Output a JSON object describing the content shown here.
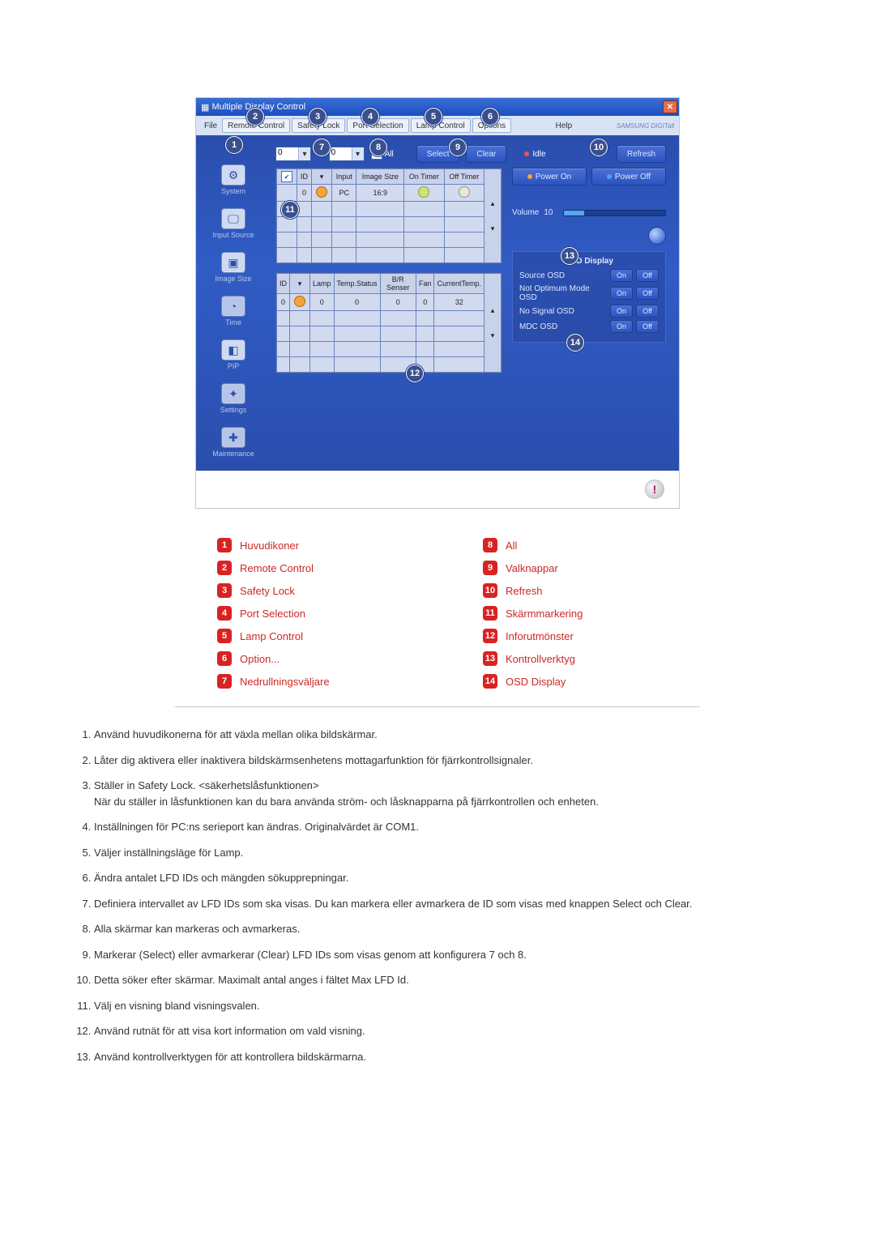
{
  "window": {
    "title": "Multiple Display Control",
    "brand": "SAMSUNG DIGITall"
  },
  "menu": {
    "file": "File",
    "remote": "Remote Control",
    "safety": "Safety Lock",
    "port": "Port Selection",
    "lamp": "Lamp Control",
    "options": "Options",
    "help": "Help"
  },
  "toolbar": {
    "drop1": "0",
    "drop2": "0",
    "all": "All",
    "select": "Select",
    "clear": "Clear",
    "idle": "Idle",
    "refresh": "Refresh"
  },
  "sidebar": {
    "system": "System",
    "input": "Input Source",
    "image": "Image Size",
    "time": "Time",
    "pip": "PIP",
    "settings": "Settings",
    "maint": "Maintenance"
  },
  "grid1": {
    "h_id": "ID",
    "h_input": "Input",
    "h_image": "Image Size",
    "h_on": "On Timer",
    "h_off": "Off Timer",
    "row_id": "0",
    "row_input": "PC",
    "row_image": "16:9"
  },
  "grid2": {
    "h_id": "ID",
    "h_lamp": "Lamp",
    "h_temp": "Temp.Status",
    "h_br": "B/R Senser",
    "h_fan": "Fan",
    "h_cur": "CurrentTemp.",
    "r_id": "0",
    "r_lamp": "0",
    "r_temp": "0",
    "r_br": "0",
    "r_fan": "0",
    "r_cur": "32"
  },
  "controls": {
    "power_on": "Power On",
    "power_off": "Power Off",
    "volume_label": "Volume",
    "volume_value": "10",
    "osd_title": "OSD Display",
    "source_osd": "Source OSD",
    "not_opt": "Not Optimum Mode OSD",
    "no_signal": "No Signal OSD",
    "mdc": "MDC OSD",
    "on": "On",
    "off": "Off"
  },
  "legend": {
    "1": "Huvudikoner",
    "2": "Remote Control",
    "3": "Safety Lock",
    "4": "Port Selection",
    "5": "Lamp Control",
    "6": "Option...",
    "7": "Nedrullningsväljare",
    "8": "All",
    "9": "Valknappar",
    "10": "Refresh",
    "11": "Skärmmarkering",
    "12": "Inforutmönster",
    "13": "Kontrollverktyg",
    "14": "OSD Display"
  },
  "prose": {
    "1": "Använd huvudikonerna för att växla mellan olika bildskärmar.",
    "2": "Låter dig aktivera eller inaktivera bildskärmsenhetens mottagarfunktion för fjärrkontrollsignaler.",
    "3a": "Ställer in Safety Lock. <säkerhetslåsfunktionen>",
    "3b": "När du ställer in låsfunktionen kan du bara använda ström- och låsknapparna på fjärrkontrollen och enheten.",
    "4": "Inställningen för PC:ns serieport kan ändras. Originalvärdet är COM1.",
    "5": "Väljer inställningsläge för Lamp.",
    "6": "Ändra antalet LFD IDs och mängden sökupprepningar.",
    "7": "Definiera intervallet av LFD IDs som ska visas. Du kan markera eller avmarkera de ID som visas med knappen Select och Clear.",
    "8": "Alla skärmar kan markeras och avmarkeras.",
    "9": "Markerar (Select) eller avmarkerar (Clear) LFD IDs som visas genom att konfigurera 7 och 8.",
    "10": "Detta söker efter skärmar. Maximalt antal anges i fältet Max LFD Id.",
    "11": "Välj en visning bland visningsvalen.",
    "12": "Använd rutnät för att visa kort information om vald visning.",
    "13": "Använd kontrollverktygen för att kontrollera bildskärmarna."
  }
}
